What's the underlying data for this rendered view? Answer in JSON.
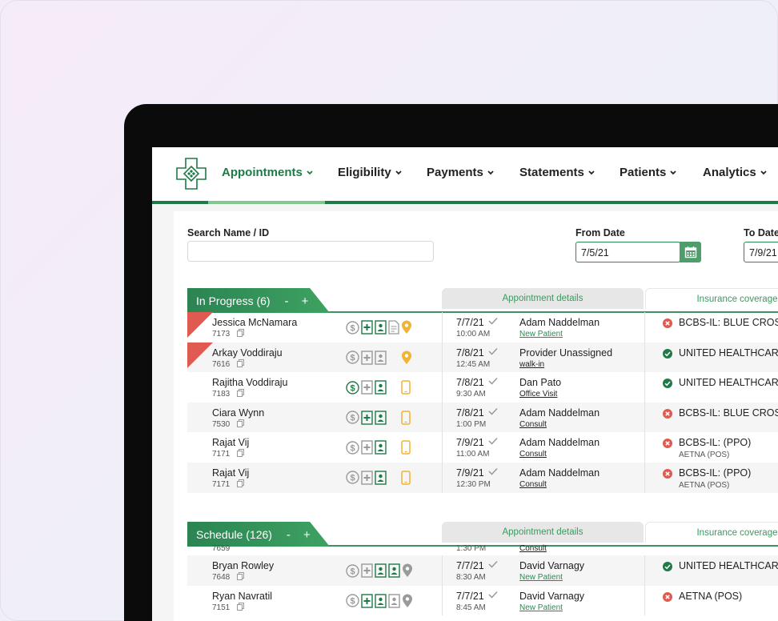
{
  "nav": {
    "items": [
      "Appointments",
      "Eligibility",
      "Payments",
      "Statements",
      "Patients",
      "Analytics"
    ]
  },
  "search": {
    "label": "Search Name / ID",
    "value": ""
  },
  "from_date": {
    "label": "From Date",
    "value": "7/5/21"
  },
  "to_date": {
    "label": "To Date",
    "value": "7/9/21"
  },
  "in_progress": {
    "title": "In Progress (6)",
    "controls": "- +",
    "col_appointment": "Appointment details",
    "col_insurance": "Insurance coverage",
    "rows": [
      {
        "name": "Jessica McNamara",
        "id": "7173",
        "date": "7/7/21",
        "time": "10:00 AM",
        "provider": "Adam Naddelman",
        "type": "New Patient",
        "insurance": "BCBS-IL: BLUE CROSS",
        "insurance2": ""
      },
      {
        "name": "Arkay Voddiraju",
        "id": "7616",
        "date": "7/8/21",
        "time": "12:45 AM",
        "provider": "Provider Unassigned",
        "type": "walk-in",
        "insurance": "UNITED HEALTHCARE",
        "insurance2": ""
      },
      {
        "name": "Rajitha Voddiraju",
        "id": "7183",
        "date": "7/8/21",
        "time": "9:30 AM",
        "provider": "Dan Pato",
        "type": "Office Visit",
        "insurance": "UNITED HEALTHCARE",
        "insurance2": ""
      },
      {
        "name": "Ciara Wynn",
        "id": "7530",
        "date": "7/8/21",
        "time": "1:00 PM",
        "provider": "Adam Naddelman",
        "type": "Consult",
        "insurance": "BCBS-IL: BLUE CROSS",
        "insurance2": ""
      },
      {
        "name": "Rajat Vij",
        "id": "7171",
        "date": "7/9/21",
        "time": "11:00 AM",
        "provider": "Adam Naddelman",
        "type": "Consult",
        "insurance": "BCBS-IL: (PPO)",
        "insurance2": "AETNA (POS)"
      },
      {
        "name": "Rajat Vij",
        "id": "7171",
        "date": "7/9/21",
        "time": "12:30 PM",
        "provider": "Adam Naddelman",
        "type": "Consult",
        "insurance": "BCBS-IL: (PPO)",
        "insurance2": "AETNA (POS)"
      }
    ]
  },
  "schedule": {
    "title": "Schedule (126)",
    "controls": "- +",
    "col_appointment": "Appointment details",
    "col_insurance": "Insurance coverage",
    "partial_row": {
      "id": "7659",
      "time": "1:30 PM",
      "type": "Consult"
    },
    "rows": [
      {
        "name": "Bryan Rowley",
        "id": "7648",
        "date": "7/7/21",
        "time": "8:30 AM",
        "provider": "David Varnagy",
        "type": "New Patient",
        "insurance": "UNITED HEALTHCARE",
        "insurance2": ""
      },
      {
        "name": "Ryan Navratil",
        "id": "7151",
        "date": "7/7/21",
        "time": "8:45 AM",
        "provider": "David Varnagy",
        "type": "New Patient",
        "insurance": "AETNA (POS)",
        "insurance2": ""
      }
    ]
  },
  "colors": {
    "brand": "#1e7a46",
    "accent": "#3ea262",
    "alert": "#e05a52",
    "pin": "#f2b233"
  }
}
